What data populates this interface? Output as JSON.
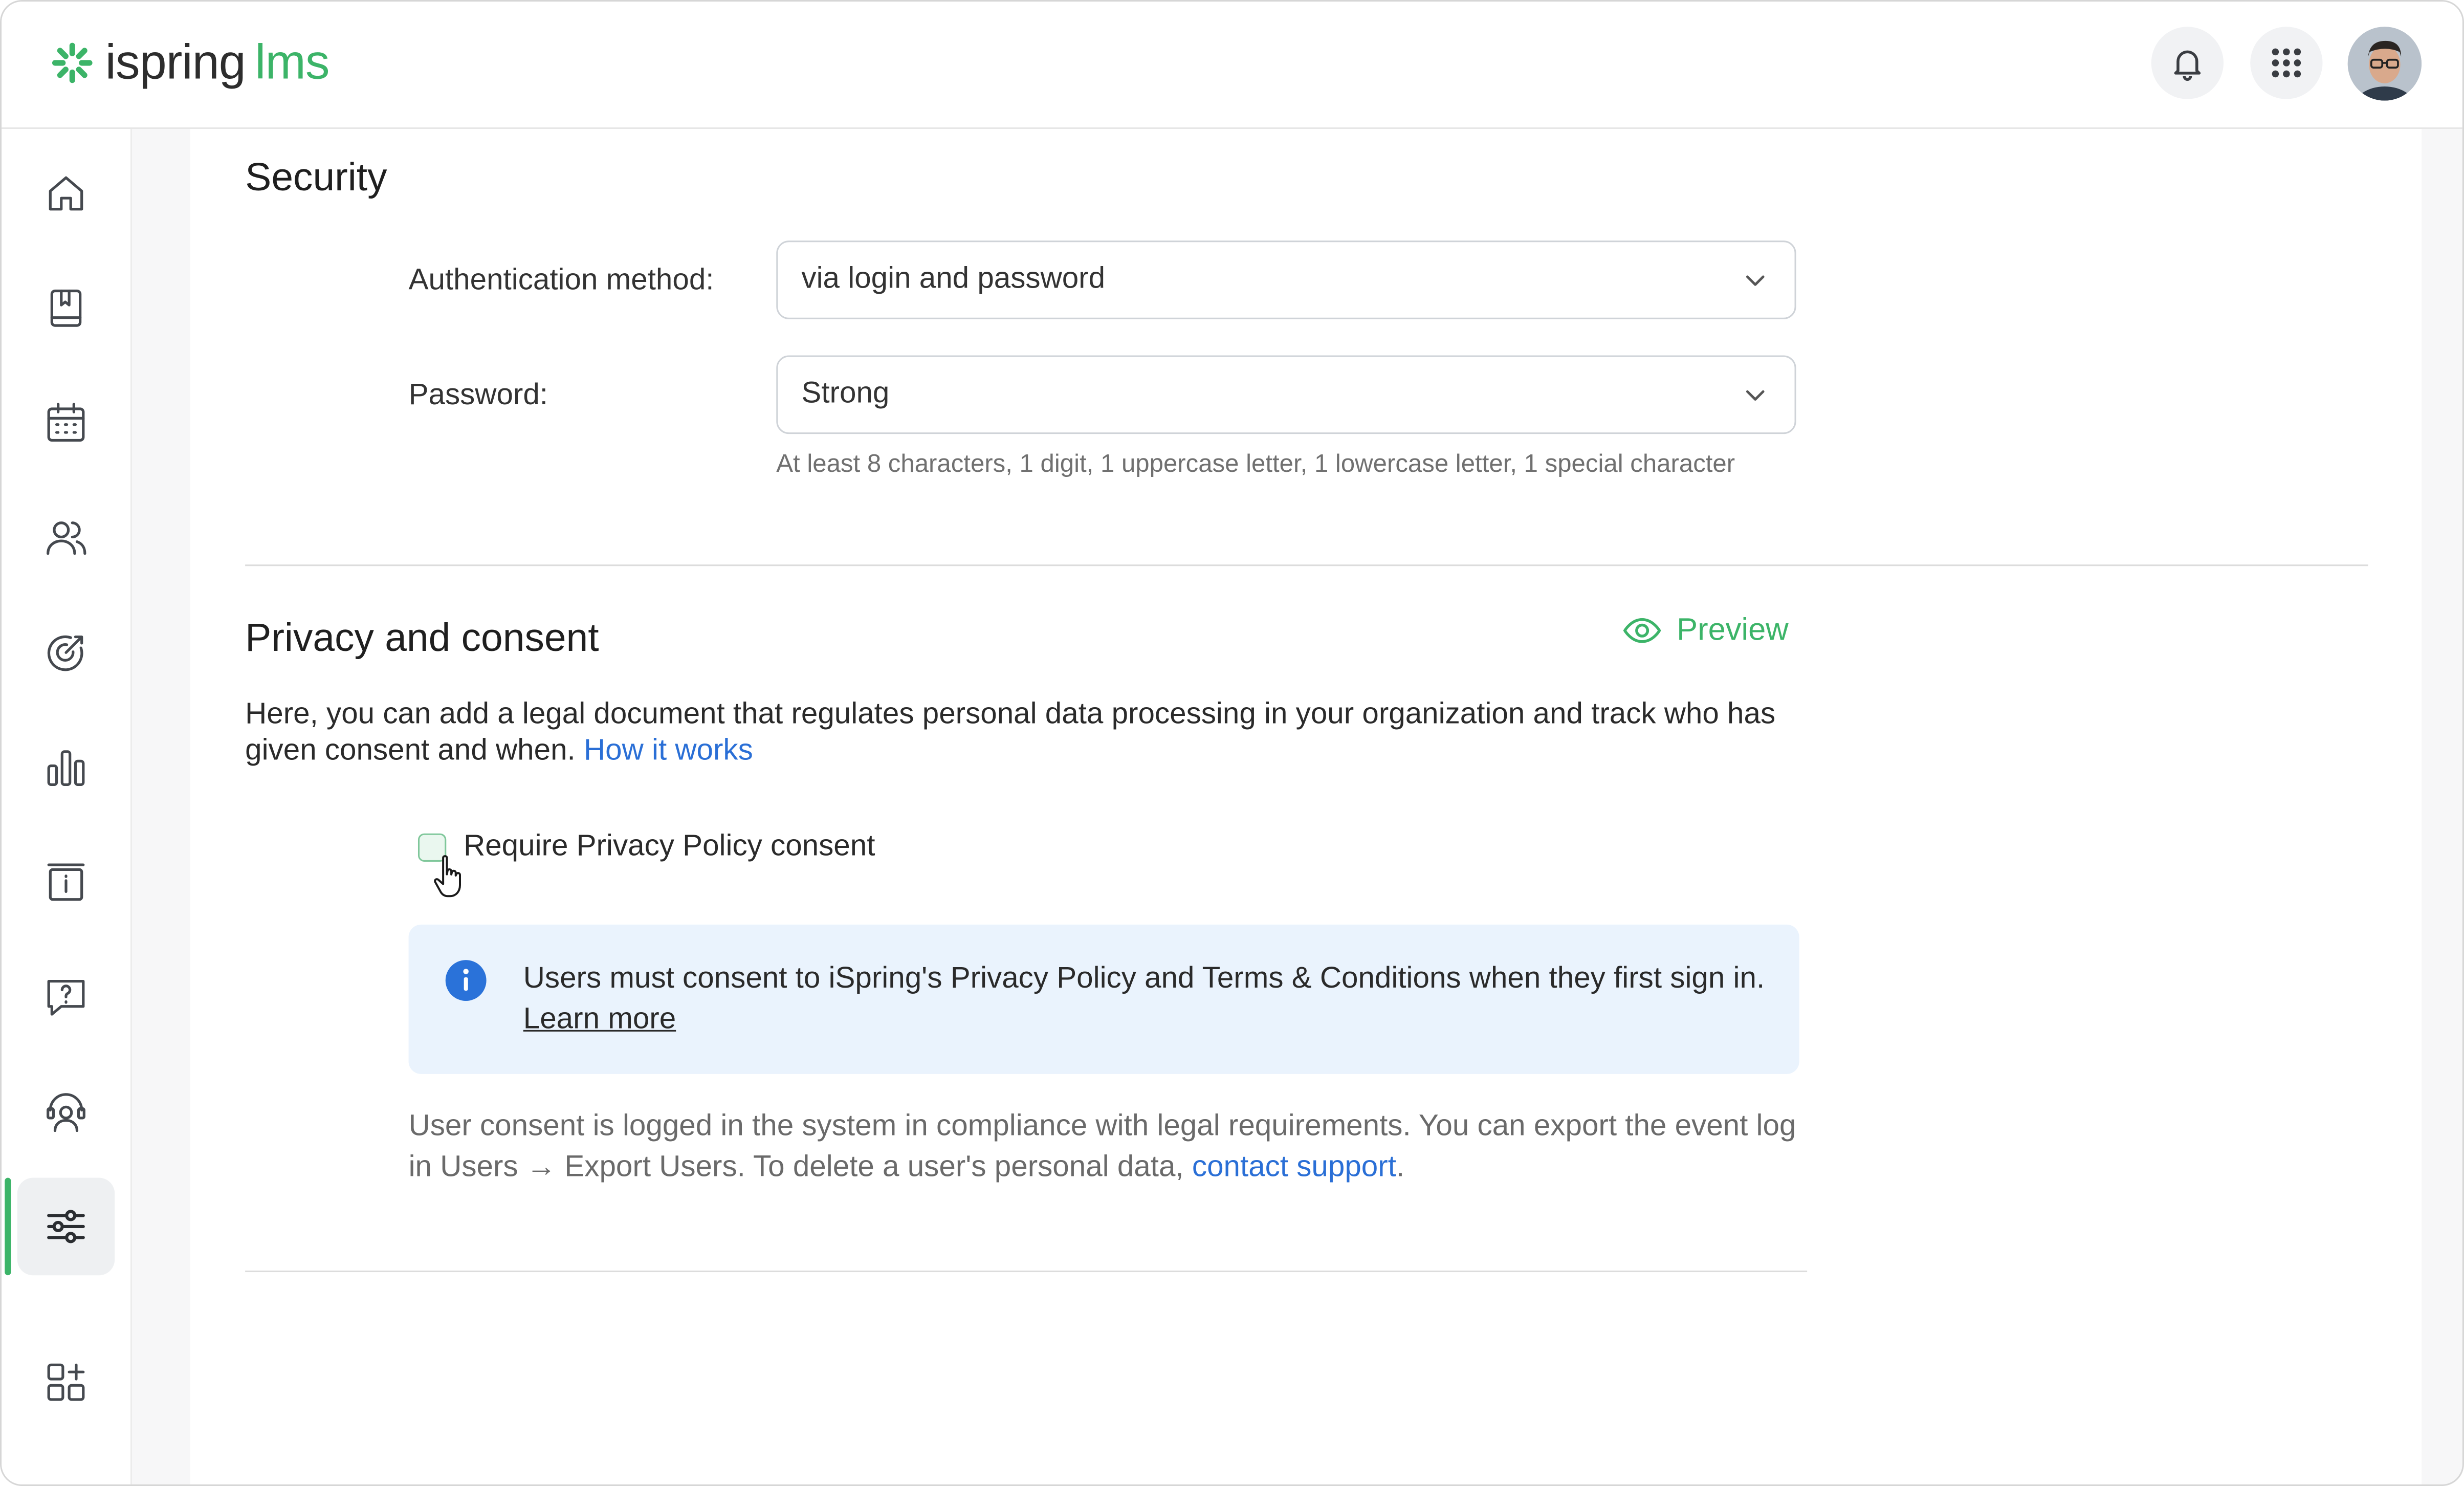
{
  "app": {
    "logo_main": "ispring",
    "logo_accent": "lms",
    "brand_color": "#3cb468"
  },
  "header": {
    "notifications_icon": "bell-icon",
    "apps_icon": "grid-icon",
    "avatar_icon": "user-avatar"
  },
  "sidebar": {
    "items": [
      {
        "name": "home",
        "icon": "home-icon"
      },
      {
        "name": "courses",
        "icon": "book-icon"
      },
      {
        "name": "calendar",
        "icon": "calendar-icon"
      },
      {
        "name": "users",
        "icon": "users-icon"
      },
      {
        "name": "goals",
        "icon": "target-icon"
      },
      {
        "name": "reports",
        "icon": "bar-chart-icon"
      },
      {
        "name": "info",
        "icon": "info-board-icon"
      },
      {
        "name": "questions",
        "icon": "question-chat-icon"
      },
      {
        "name": "support",
        "icon": "support-agent-icon"
      },
      {
        "name": "settings",
        "icon": "sliders-icon",
        "active": true
      },
      {
        "name": "add-apps",
        "icon": "add-widget-icon"
      }
    ]
  },
  "security": {
    "title": "Security",
    "auth_label": "Authentication method:",
    "auth_value": "via login and password",
    "password_label": "Password:",
    "password_value": "Strong",
    "password_hint": "At least 8 characters, 1 digit, 1 uppercase letter, 1 lowercase letter, 1 special character"
  },
  "privacy": {
    "title": "Privacy and consent",
    "preview_label": "Preview",
    "description": "Here, you can add a legal document that regulates personal data processing in your organization and track who has given consent and when.",
    "how_it_works": "How it works",
    "checkbox_label": "Require Privacy Policy consent",
    "checkbox_checked": false,
    "info_text": "Users must consent to iSpring's Privacy Policy and Terms & Conditions when they first sign in.",
    "learn_more": "Learn more",
    "note_text": "User consent is logged in the system in compliance with legal requirements. You can export the event log in Users → Export Users. To delete a user's personal data,",
    "contact_support": "contact support",
    "note_end": "."
  }
}
